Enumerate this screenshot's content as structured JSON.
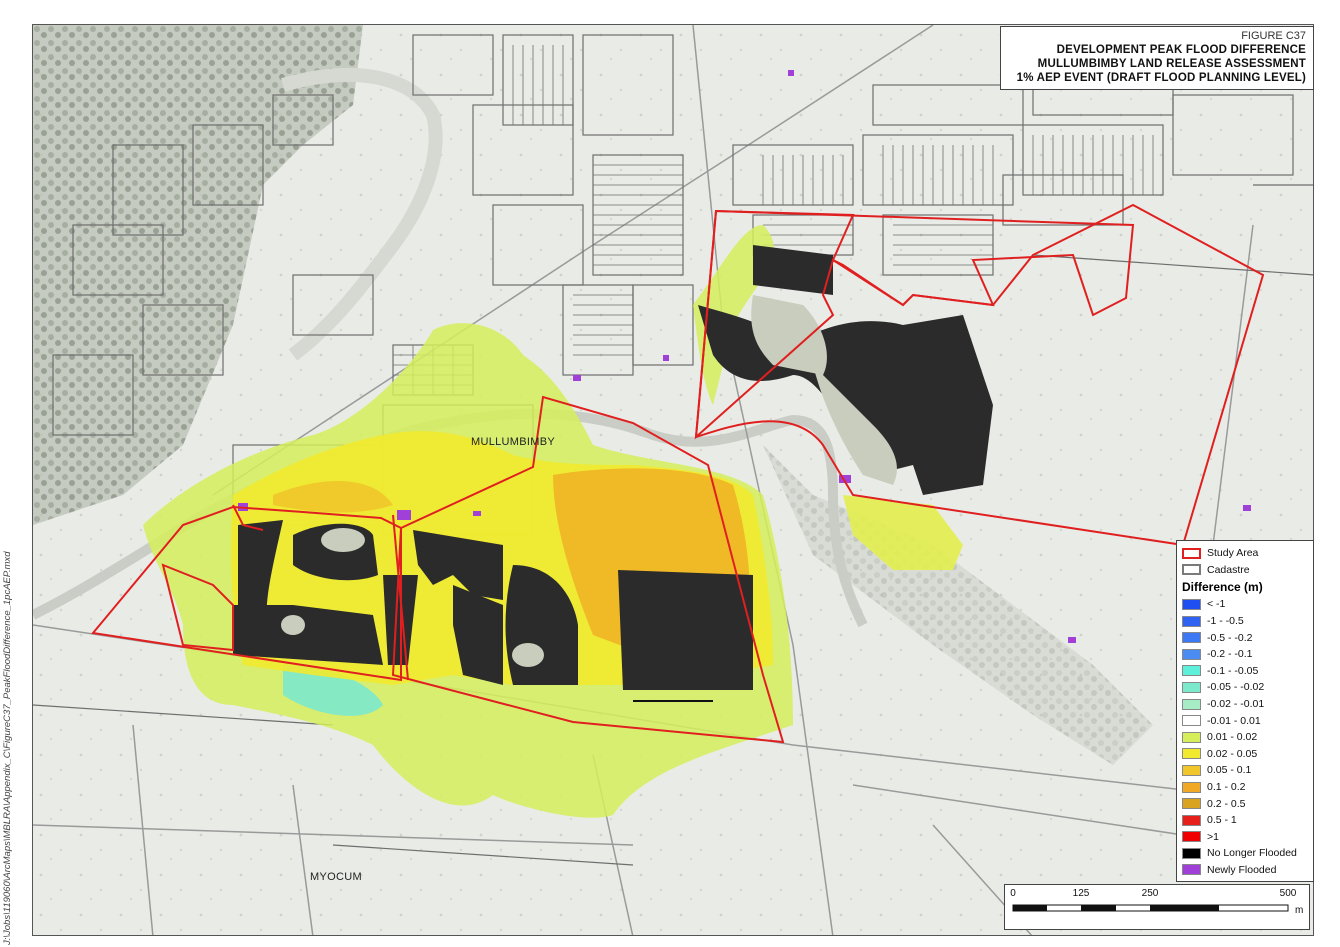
{
  "title": {
    "figure": "FIGURE C37",
    "lines": [
      "DEVELOPMENT PEAK FLOOD DIFFERENCE",
      "MULLUMBIMBY LAND RELEASE ASSESSMENT",
      "1% AEP EVENT (DRAFT FLOOD PLANNING LEVEL)"
    ]
  },
  "places": {
    "mullumbimby": "MULLUMBIMBY",
    "myocum": "MYOCUM"
  },
  "legend": {
    "study_area": "Study Area",
    "cadastre": "Cadastre",
    "heading": "Difference (m)",
    "classes": [
      {
        "label": "< -1",
        "color": "#1f4ff0"
      },
      {
        "label": "-1 - -0.5",
        "color": "#2f62f2"
      },
      {
        "label": "-0.5 - -0.2",
        "color": "#3c78f3"
      },
      {
        "label": "-0.2 - -0.1",
        "color": "#4a8cf2"
      },
      {
        "label": "-0.1 - -0.05",
        "color": "#5ff0dc"
      },
      {
        "label": "-0.05 - -0.02",
        "color": "#7ce8cc"
      },
      {
        "label": "-0.02 - -0.01",
        "color": "#a6ecc4"
      },
      {
        "label": "-0.01 - 0.01",
        "color": "#ffffff"
      },
      {
        "label": "0.01 - 0.02",
        "color": "#d5ee5a"
      },
      {
        "label": "0.02 - 0.05",
        "color": "#f2ea2e"
      },
      {
        "label": "0.05 - 0.1",
        "color": "#f0c62a"
      },
      {
        "label": "0.1 - 0.2",
        "color": "#f0a825"
      },
      {
        "label": "0.2 - 0.5",
        "color": "#d9a320"
      },
      {
        "label": "0.5 - 1",
        "color": "#e8201c"
      },
      {
        "label": ">1",
        "color": "#f00000"
      },
      {
        "label": "No Longer Flooded",
        "color": "#000000"
      },
      {
        "label": "Newly Flooded",
        "color": "#a040d8"
      }
    ],
    "study_area_color": "#e02020",
    "cadastre_color": "#7a7a7a"
  },
  "scale": {
    "ticks": [
      "0",
      "125",
      "250",
      "500"
    ],
    "unit": "m"
  },
  "file_path": "J:\\Jobs\\119060\\ArcMaps\\MBLRA\\Appendix_C\\FigureC37_PeakFloodDifference_1pcAEP.mxd"
}
